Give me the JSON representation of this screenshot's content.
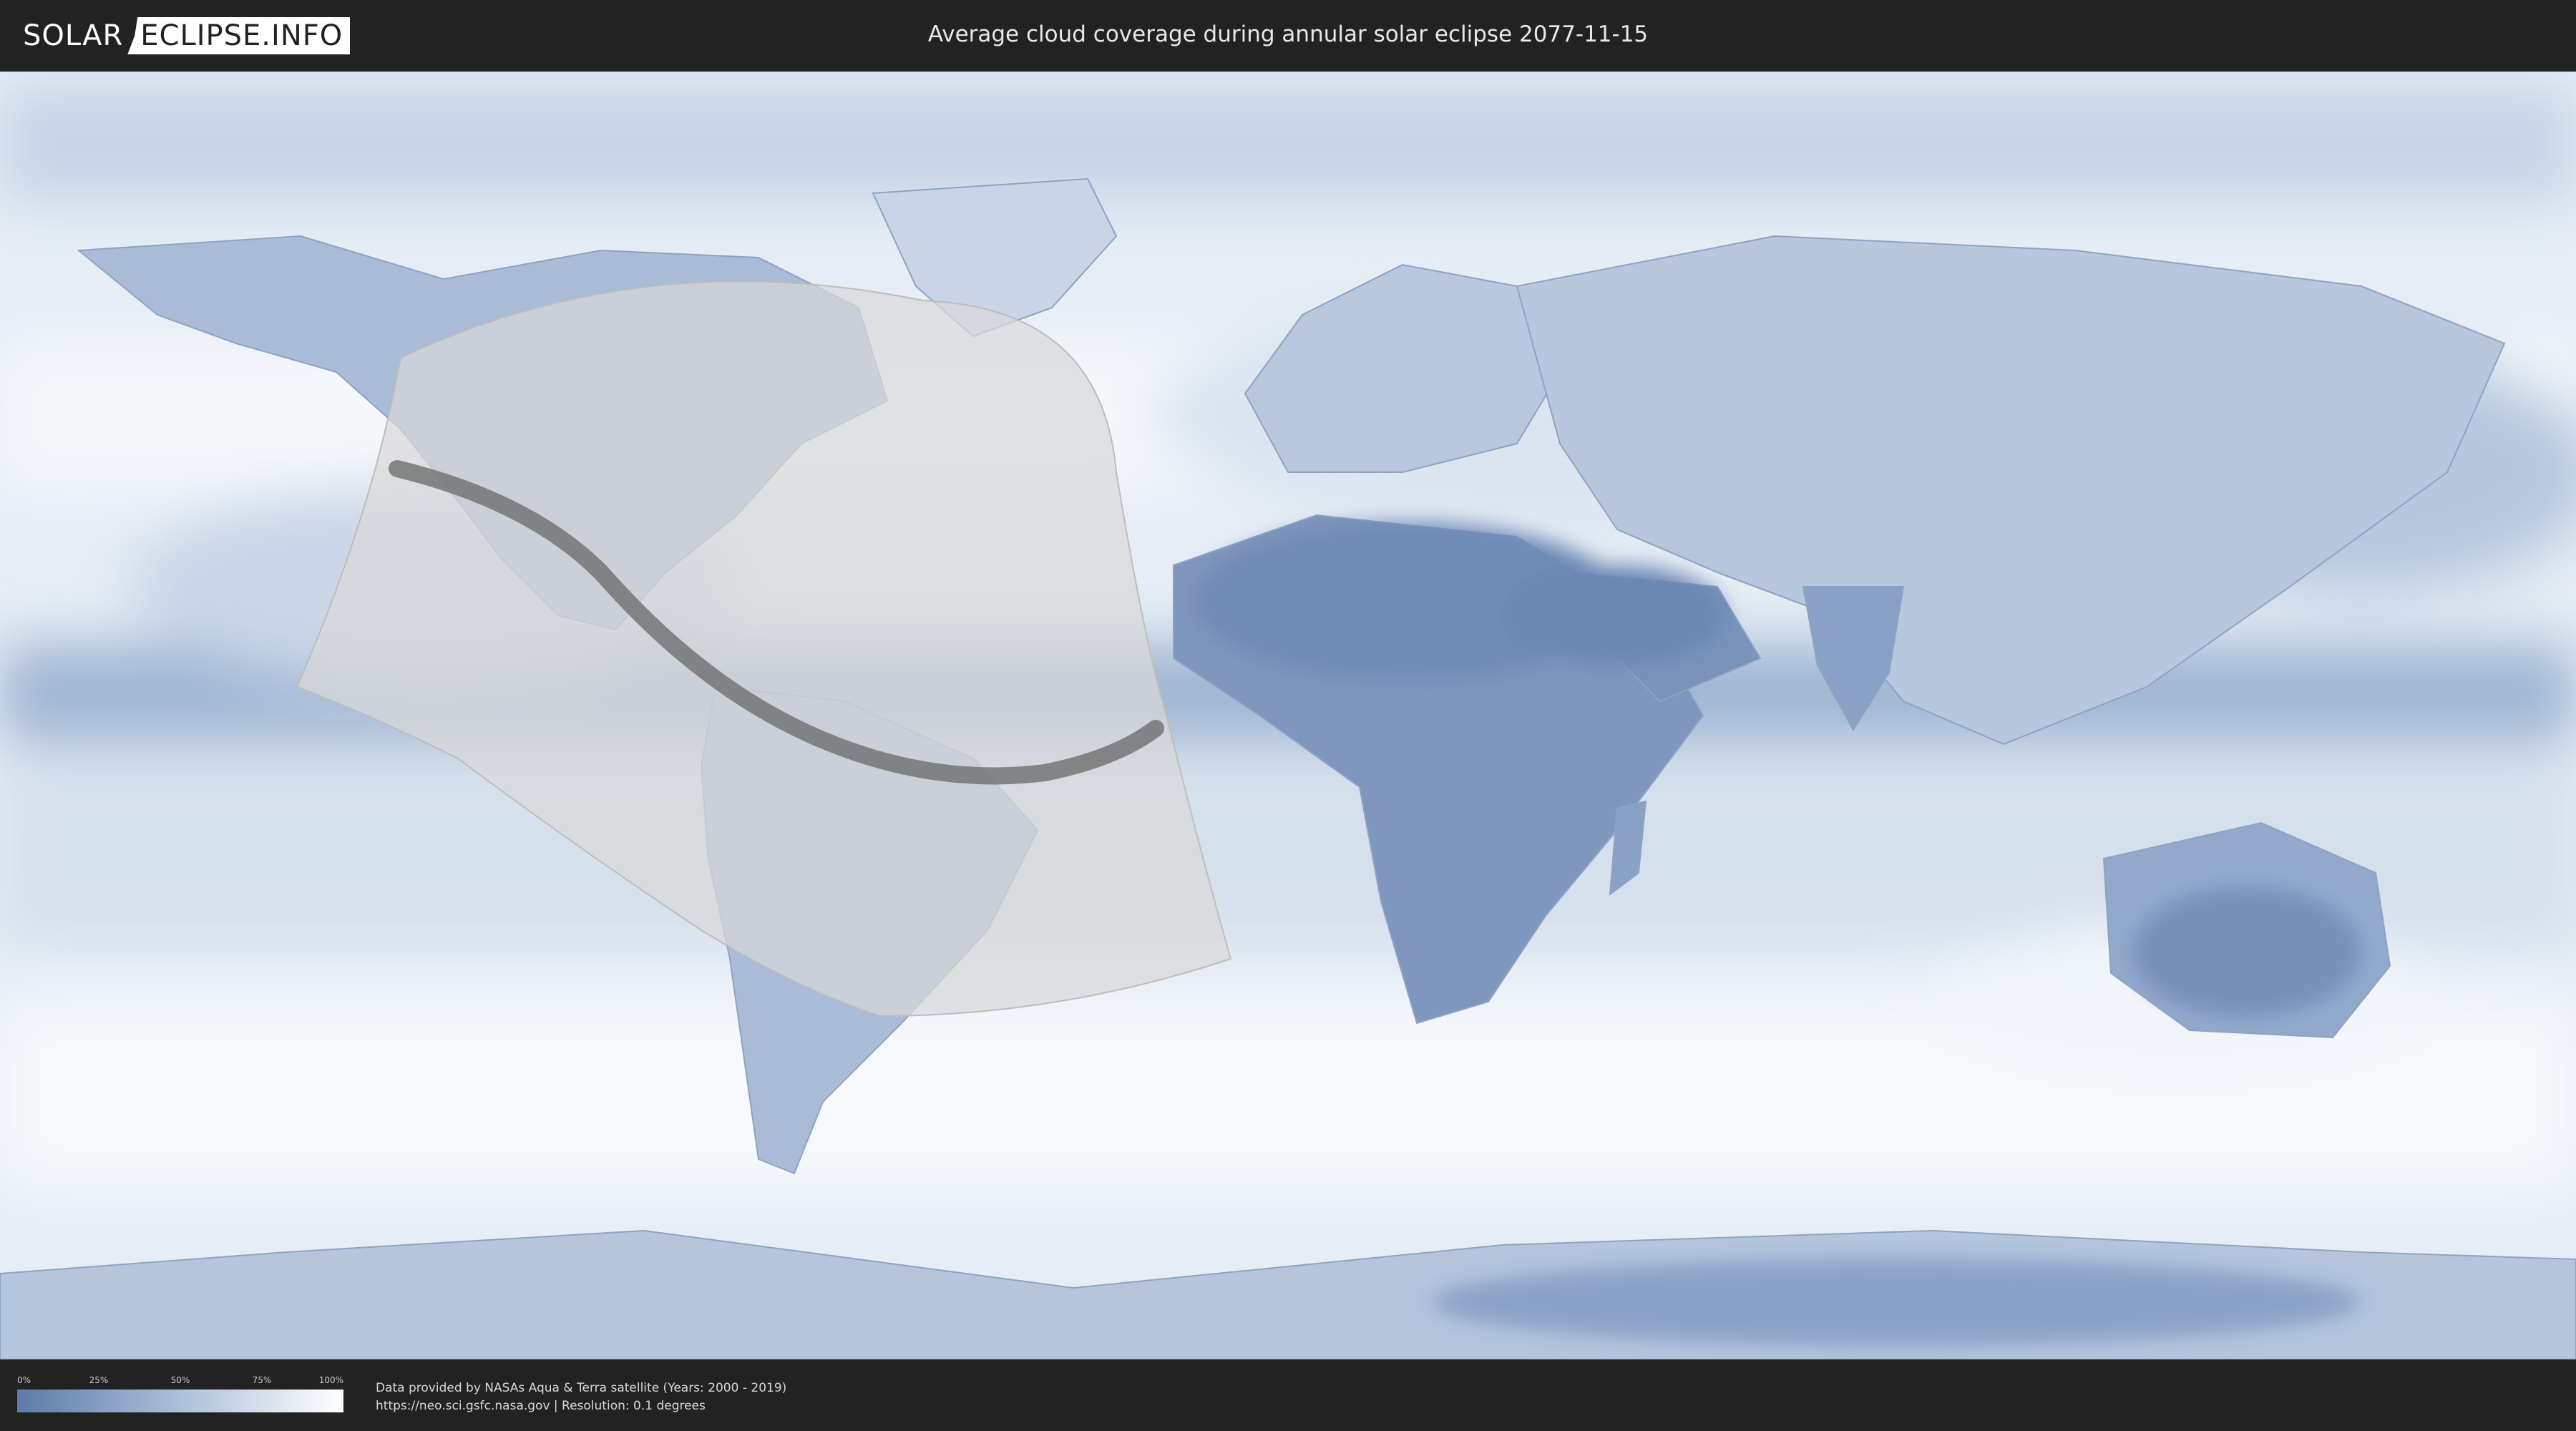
{
  "header": {
    "logo_solar": "SOLAR",
    "logo_eclipse": "ECLIPSE.INFO",
    "title": "Average cloud coverage during annular solar eclipse 2077-11-15"
  },
  "legend": {
    "ticks": [
      "0%",
      "25%",
      "50%",
      "75%",
      "100%"
    ],
    "colors": {
      "low": "#5d7aa8",
      "mid": "#a6b9d4",
      "high": "#ffffff"
    }
  },
  "credits": {
    "line1": "Data provided by NASAs Aqua & Terra satellite (Years: 2000 - 2019)",
    "line2": "https://neo.sci.gsfc.nasa.gov | Resolution: 0.1 degrees"
  },
  "colors": {
    "background": "#222222",
    "ocean_cloud": "#e6edf5",
    "land_clear": "#7f97bf",
    "penumbra": "#d8d8d8",
    "annular_path": "#6e6e6e"
  }
}
